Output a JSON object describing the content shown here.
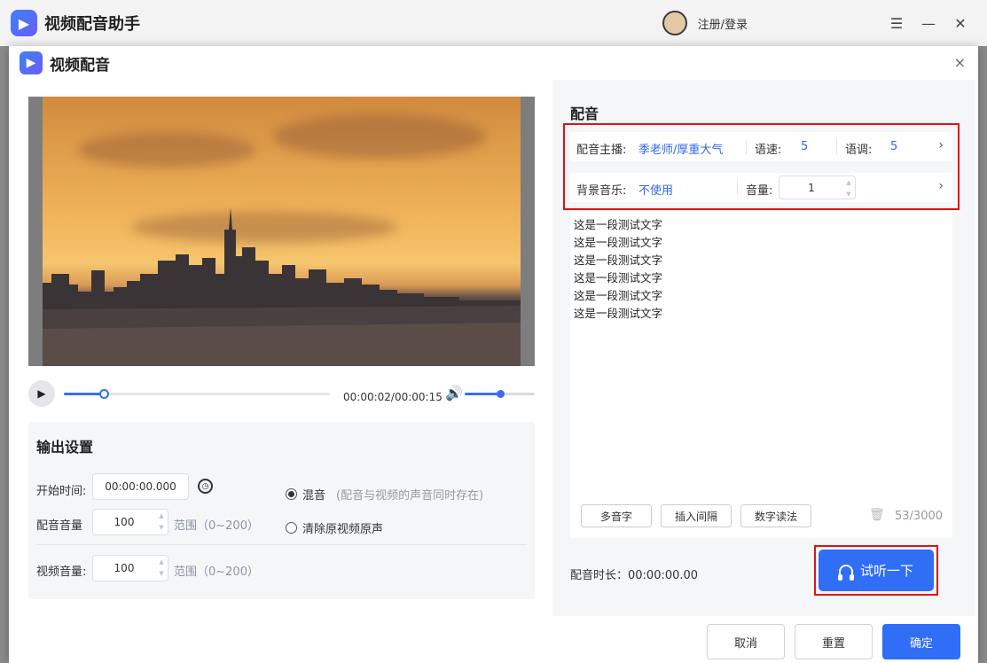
{
  "app": {
    "title": "视频配音助手",
    "login_label": "注册/登录",
    "menu_icon": "☰",
    "minimize_icon": "—",
    "close_icon": "✕"
  },
  "dialog": {
    "title": "视频配音",
    "close_icon": "×"
  },
  "player": {
    "time_readout": "00:00:02/00:00:15",
    "progress": 0.15,
    "volume_level": 0.5
  },
  "output": {
    "title": "输出设置",
    "start_time_label": "开始时间:",
    "start_time_value": "00:00:00.000",
    "dub_volume_label": "配音音量",
    "dub_volume_value": "100",
    "dub_volume_range": "范围（0~200）",
    "video_volume_label": "视频音量:",
    "video_volume_value": "100",
    "video_volume_range": "范围（0~200）",
    "mix_label": "混音",
    "mix_hint": "(配音与视频的声音同时存在)",
    "remove_label": "清除原视频原声"
  },
  "dubbing": {
    "title": "配音",
    "anchor_label": "配音主播:",
    "anchor_value": "季老师/厚重大气",
    "speed_label": "语速:",
    "speed_value": "5",
    "pitch_label": "语调:",
    "pitch_value": "5",
    "bgm_label": "背景音乐:",
    "bgm_value": "不使用",
    "volume_label": "音量:",
    "volume_value": "1",
    "text_lines": [
      "这是一段测试文字",
      "这是一段测试文字",
      "这是一段测试文字",
      "这是一段测试文字",
      "这是一段测试文字",
      "这是一段测试文字"
    ],
    "tools": {
      "polyphone": "多音字",
      "insert_pause": "插入间隔",
      "number_reading": "数字读法"
    },
    "char_count": "53/3000",
    "duration": "配音时长：00:00:00.00",
    "listen_label": "试听一下"
  },
  "footer": {
    "cancel": "取消",
    "reset": "重置",
    "confirm": "确定"
  },
  "colors": {
    "accent": "#2f6ef5",
    "highlight_border": "#e0101a"
  }
}
